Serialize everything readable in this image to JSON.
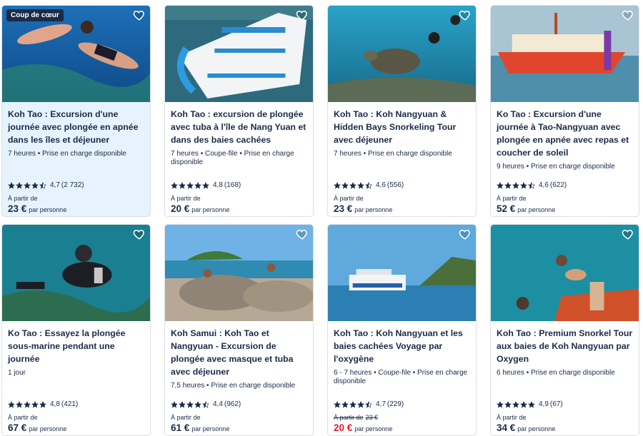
{
  "cards": [
    {
      "badge": "Coup de cœur",
      "title": "Koh Tao : Excursion d'une journée avec plongée en apnée dans les îles et déjeuner",
      "meta": "7 heures • Prise en charge disponible",
      "stars": 4.5,
      "rating": "4,7",
      "reviews": "(2 732)",
      "from": "À partir de",
      "old_price": "",
      "price": "23 €",
      "per": "par personne"
    },
    {
      "badge": "",
      "title": "Koh Tao : excursion de plongée avec tuba à l'île de Nang Yuan et dans des baies cachées",
      "meta": "7 heures • Coupe-file • Prise en charge disponible",
      "stars": 5,
      "rating": "4,8",
      "reviews": "(168)",
      "from": "À partir de",
      "old_price": "",
      "price": "20 €",
      "per": "par personne"
    },
    {
      "badge": "",
      "title": "Koh Tao : Koh Nangyuan & Hidden Bays Snorkeling Tour avec déjeuner",
      "meta": "7 heures • Prise en charge disponible",
      "stars": 4.5,
      "rating": "4,6",
      "reviews": "(556)",
      "from": "À partir de",
      "old_price": "",
      "price": "23 €",
      "per": "par personne"
    },
    {
      "badge": "",
      "title": "Ko Tao : Excursion d'une journée à Tao-Nangyuan avec plongée en apnée avec repas et coucher de soleil",
      "meta": "9 heures • Prise en charge disponible",
      "stars": 4.5,
      "rating": "4,6",
      "reviews": "(622)",
      "from": "À partir de",
      "old_price": "",
      "price": "52 €",
      "per": "par personne"
    },
    {
      "badge": "",
      "title": "Ko Tao : Essayez la plongée sous-marine pendant une journée",
      "meta": "1 jour",
      "stars": 5,
      "rating": "4,8",
      "reviews": "(421)",
      "from": "À partir de",
      "old_price": "",
      "price": "67 €",
      "per": "par personne"
    },
    {
      "badge": "",
      "title": "Koh Samui : Koh Tao et Nangyuan - Excursion de plongée avec masque et tuba avec déjeuner",
      "meta": "7,5 heures • Prise en charge disponible",
      "stars": 4.5,
      "rating": "4,4",
      "reviews": "(962)",
      "from": "À partir de",
      "old_price": "",
      "price": "61 €",
      "per": "par personne"
    },
    {
      "badge": "",
      "title": "Koh Tao : Koh Nangyuan et les baies cachées Voyage par l'oxygène",
      "meta": "6 - 7 heures • Coupe-file • Prise en charge disponible",
      "stars": 4.5,
      "rating": "4,7",
      "reviews": "(229)",
      "from": "À partir de",
      "old_price": "23 €",
      "price": "20 €",
      "per": "par personne"
    },
    {
      "badge": "",
      "title": "Koh Tao : Premium Snorkel Tour aux baies de Koh Nangyuan par Oxygen",
      "meta": "6 heures • Prise en charge disponible",
      "stars": 5,
      "rating": "4,9",
      "reviews": "(67)",
      "from": "À partir de",
      "old_price": "",
      "price": "34 €",
      "per": "par personne"
    }
  ],
  "colors": {
    "accent": "#1a2b49",
    "sale": "#dc1e30",
    "highlight": "#e6f2fd"
  }
}
